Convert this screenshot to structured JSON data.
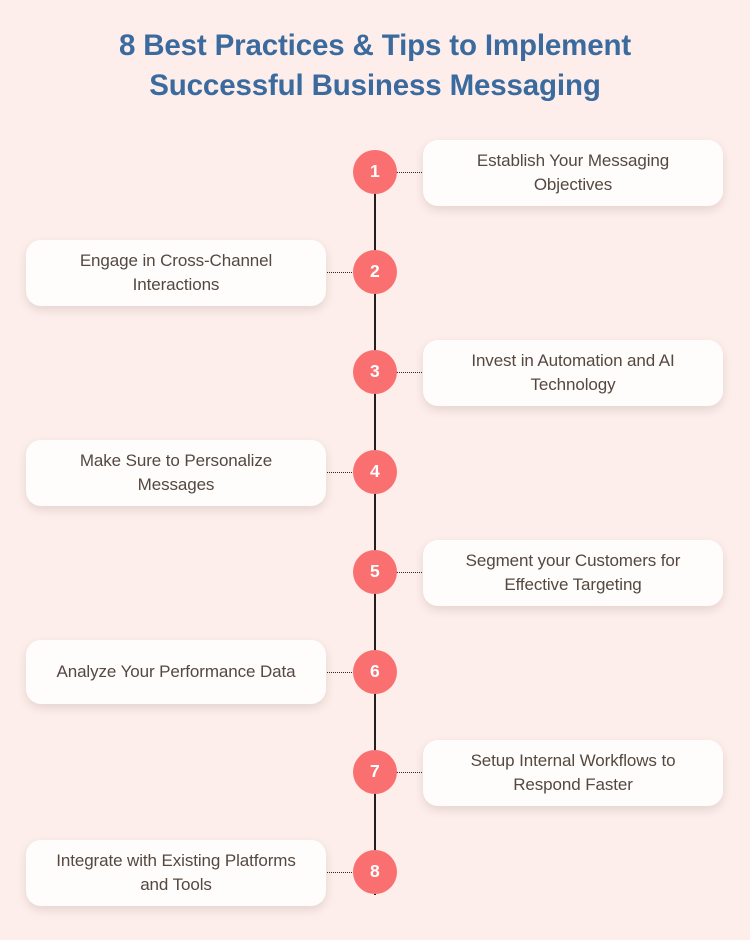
{
  "header": {
    "title": "8 Best Practices & Tips to Implement Successful Business Messaging",
    "title_color": "#3a6a9e"
  },
  "theme": {
    "background_color": "#fdeeeb",
    "marker_color": "#fa7070",
    "marker_number_color": "#ffffff",
    "card_background": "#fffdfc",
    "card_text_color": "#544840",
    "line_color": "#21201f"
  },
  "timeline": {
    "steps": [
      {
        "number": "1",
        "label": "Establish Your Messaging Objectives",
        "side": "right"
      },
      {
        "number": "2",
        "label": "Engage in Cross-Channel Interactions",
        "side": "left"
      },
      {
        "number": "3",
        "label": "Invest in Automation and AI Technology",
        "side": "right"
      },
      {
        "number": "4",
        "label": "Make Sure to Personalize Messages",
        "side": "left"
      },
      {
        "number": "5",
        "label": "Segment your Customers for Effective Targeting",
        "side": "right"
      },
      {
        "number": "6",
        "label": "Analyze Your Performance Data",
        "side": "left"
      },
      {
        "number": "7",
        "label": "Setup Internal Workflows to Respond Faster",
        "side": "right"
      },
      {
        "number": "8",
        "label": "Integrate with Existing Platforms and Tools",
        "side": "left"
      }
    ]
  }
}
